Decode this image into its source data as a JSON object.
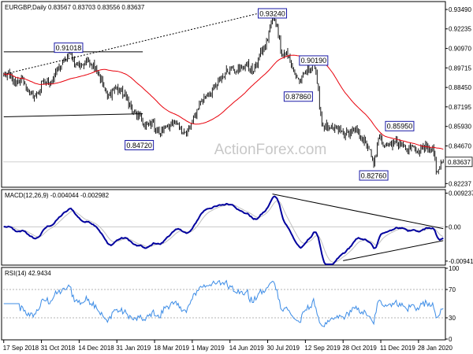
{
  "chart_data": [
    {
      "type": "candlestick",
      "title": "EURGBP,Daily  0.83567 0.83703 0.83556 0.83637",
      "watermark": "ActionForex.com",
      "ylim": [
        0.8205,
        0.9395
      ],
      "y_ticks": [
        {
          "value": 0.9349,
          "label": "0.93490"
        },
        {
          "value": 0.92235,
          "label": "0.92235"
        },
        {
          "value": 0.9097,
          "label": "0.90970"
        },
        {
          "value": 0.89715,
          "label": "0.89715"
        },
        {
          "value": 0.8845,
          "label": "0.88450"
        },
        {
          "value": 0.87195,
          "label": "0.87195"
        },
        {
          "value": 0.8593,
          "label": "0.85930"
        },
        {
          "value": 0.8467,
          "label": "0.84670"
        },
        {
          "value": 0.82237,
          "label": "0.82237"
        }
      ],
      "current_price": {
        "value": 0.83637,
        "label": "0.83637"
      },
      "x_ticks": [
        {
          "index": 0,
          "label": "17 Sep 2018"
        },
        {
          "index": 32,
          "label": "31 Oct 2018"
        },
        {
          "index": 64,
          "label": "14 Dec 2018"
        },
        {
          "index": 96,
          "label": "31 Jan 2019"
        },
        {
          "index": 128,
          "label": "18 Mar 2019"
        },
        {
          "index": 160,
          "label": "1 May 2019"
        },
        {
          "index": 192,
          "label": "14 Jun 2019"
        },
        {
          "index": 224,
          "label": "30 Jul 2019"
        },
        {
          "index": 256,
          "label": "12 Sep 2019"
        },
        {
          "index": 288,
          "label": "28 Oct 2019"
        },
        {
          "index": 320,
          "label": "11 Dec 2019"
        },
        {
          "index": 352,
          "label": "28 Jan 2020"
        }
      ],
      "n_bars": 374,
      "close_anchors": [
        [
          0,
          0.893
        ],
        [
          5,
          0.892
        ],
        [
          10,
          0.886
        ],
        [
          16,
          0.89
        ],
        [
          22,
          0.88
        ],
        [
          27,
          0.879
        ],
        [
          34,
          0.888
        ],
        [
          40,
          0.888
        ],
        [
          46,
          0.896
        ],
        [
          52,
          0.902
        ],
        [
          56,
          0.907
        ],
        [
          61,
          0.9
        ],
        [
          66,
          0.899
        ],
        [
          72,
          0.902
        ],
        [
          78,
          0.898
        ],
        [
          84,
          0.887
        ],
        [
          88,
          0.878
        ],
        [
          94,
          0.884
        ],
        [
          99,
          0.882
        ],
        [
          104,
          0.878
        ],
        [
          110,
          0.868
        ],
        [
          115,
          0.866
        ],
        [
          120,
          0.859
        ],
        [
          126,
          0.862
        ],
        [
          132,
          0.854
        ],
        [
          138,
          0.86
        ],
        [
          144,
          0.861
        ],
        [
          150,
          0.859
        ],
        [
          155,
          0.854
        ],
        [
          160,
          0.862
        ],
        [
          166,
          0.874
        ],
        [
          172,
          0.879
        ],
        [
          180,
          0.885
        ],
        [
          188,
          0.894
        ],
        [
          194,
          0.898
        ],
        [
          200,
          0.896
        ],
        [
          206,
          0.899
        ],
        [
          212,
          0.895
        ],
        [
          217,
          0.905
        ],
        [
          222,
          0.911
        ],
        [
          228,
          0.929
        ],
        [
          232,
          0.924
        ],
        [
          236,
          0.906
        ],
        [
          240,
          0.908
        ],
        [
          244,
          0.899
        ],
        [
          248,
          0.892
        ],
        [
          252,
          0.888
        ],
        [
          256,
          0.895
        ],
        [
          260,
          0.896
        ],
        [
          263,
          0.902
        ],
        [
          266,
          0.887
        ],
        [
          270,
          0.861
        ],
        [
          276,
          0.857
        ],
        [
          282,
          0.858
        ],
        [
          290,
          0.854
        ],
        [
          298,
          0.857
        ],
        [
          304,
          0.852
        ],
        [
          310,
          0.845
        ],
        [
          314,
          0.833
        ],
        [
          318,
          0.852
        ],
        [
          324,
          0.848
        ],
        [
          330,
          0.849
        ],
        [
          336,
          0.849
        ],
        [
          342,
          0.844
        ],
        [
          348,
          0.846
        ],
        [
          352,
          0.842
        ],
        [
          356,
          0.847
        ],
        [
          360,
          0.844
        ],
        [
          364,
          0.846
        ],
        [
          367,
          0.83
        ],
        [
          370,
          0.832
        ],
        [
          373,
          0.8364
        ]
      ],
      "ma_period": 55,
      "ma_color": "#e8000b",
      "candle_color": "#000000",
      "hlines": [
        {
          "value": 0.83637,
          "color": "#c8c8c8"
        }
      ],
      "trendlines": [
        {
          "style": "dotted",
          "points": [
            [
              0,
              0.893
            ],
            [
              228,
              0.9345
            ]
          ]
        },
        {
          "style": "solid",
          "points": [
            [
              0,
              0.9075
            ],
            [
              118,
              0.9075
            ]
          ]
        },
        {
          "style": "solid",
          "points": [
            [
              0,
              0.8655
            ],
            [
              118,
              0.8675
            ]
          ]
        }
      ],
      "annotations": [
        {
          "label": "0.91018",
          "index": 55,
          "value": 0.91018
        },
        {
          "label": "0.93240",
          "index": 228,
          "value": 0.9324
        },
        {
          "label": "0.90190",
          "index": 263,
          "value": 0.9019
        },
        {
          "label": "0.87860",
          "index": 250,
          "value": 0.8786
        },
        {
          "label": "0.84720",
          "index": 115,
          "value": 0.8472
        },
        {
          "label": "0.85950",
          "index": 336,
          "value": 0.8595
        },
        {
          "label": "0.82760",
          "index": 314,
          "value": 0.8276
        }
      ]
    },
    {
      "type": "line",
      "title": "MACD(12,26,9) -0.004044 -0.002982",
      "ylim": [
        -0.0103,
        0.01
      ],
      "y_ticks": [
        {
          "value": 0.009237,
          "label": "0.009237"
        },
        {
          "value": 0.0,
          "label": "0.00"
        },
        {
          "value": -0.009413,
          "label": "-0.009413"
        }
      ],
      "macd_color": "#00009e",
      "signal_color": "#c0c0c0",
      "zero_color": "#c0c0c0",
      "trendlines": [
        {
          "style": "solid",
          "points": [
            [
              228,
              0.009
            ],
            [
              373,
              -0.0005
            ]
          ]
        },
        {
          "style": "solid",
          "points": [
            [
              288,
              -0.0093
            ],
            [
              373,
              -0.0038
            ]
          ]
        }
      ]
    },
    {
      "type": "line",
      "title": "RSI(14) 42.9434",
      "ylim": [
        0,
        100
      ],
      "y_ticks": [
        {
          "value": 100,
          "label": "100"
        },
        {
          "value": 70,
          "label": "70"
        },
        {
          "value": 30,
          "label": "30"
        },
        {
          "value": 0,
          "label": "0"
        }
      ],
      "levels": [
        70,
        30
      ],
      "rsi_color": "#3c8ce6",
      "period": 14
    }
  ]
}
